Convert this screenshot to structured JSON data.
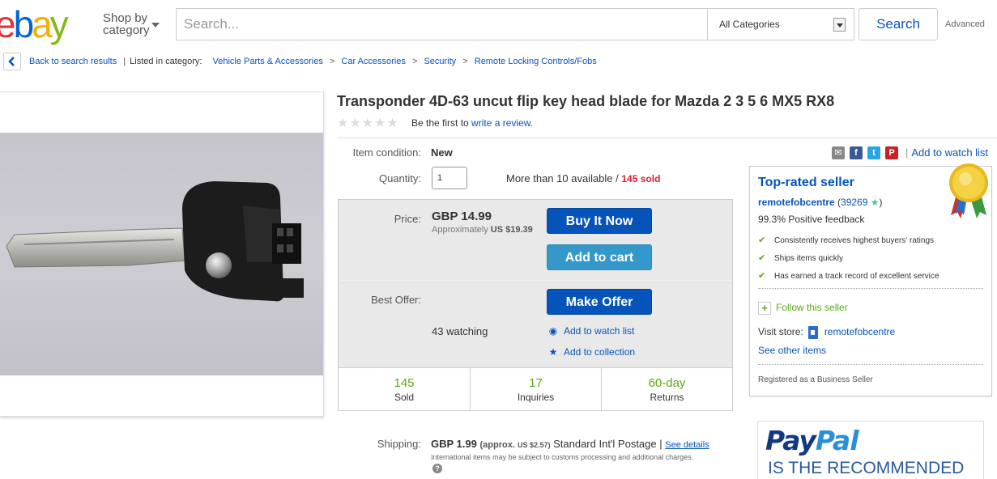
{
  "header": {
    "logo_text": "ebay",
    "shop_by_line1": "Shop by",
    "shop_by_line2": "category",
    "search_placeholder": "Search...",
    "category_selected": "All Categories",
    "search_button": "Search",
    "advanced_link": "Advanced"
  },
  "breadcrumb": {
    "back": "Back to search results",
    "listed_in": "Listed in category:",
    "items": [
      "Vehicle Parts & Accessories",
      "Car Accessories",
      "Security",
      "Remote Locking Controls/Fobs"
    ],
    "separator": ">"
  },
  "listing": {
    "title": "Transponder 4D-63 uncut flip key head blade for Mazda 2 3 5 6 MX5 RX8",
    "stars": "★★★★★",
    "review_prefix": "Be the first to",
    "review_link": "write a review.",
    "condition_label": "Item condition:",
    "condition_value": "New",
    "quantity_label": "Quantity:",
    "quantity_value": "1",
    "availability": "More than 10 available / ",
    "sold_text": "145 sold"
  },
  "buy_box": {
    "price_label": "Price:",
    "price_value": "GBP 14.99",
    "approx_prefix": "Approximately",
    "approx_value": "US $19.39",
    "buy_now": "Buy It Now",
    "add_to_cart": "Add to cart",
    "best_offer_label": "Best Offer:",
    "make_offer": "Make Offer",
    "watching": "43 watching",
    "add_watch_list": "Add to watch list",
    "add_collection": "Add to collection",
    "stats": [
      {
        "number": "145",
        "label": "Sold"
      },
      {
        "number": "17",
        "label": "Inquiries"
      },
      {
        "number": "60-day",
        "label": "Returns"
      }
    ]
  },
  "shipping": {
    "label": "Shipping:",
    "cost": "GBP 1.99",
    "approx_prefix": "(approx.",
    "approx_us": "US $2.57)",
    "service": "Standard Int'l Postage",
    "separator": "|",
    "details_link": "See details",
    "note": "International items may be subject to customs processing and additional charges.",
    "help_glyph": "?"
  },
  "share": {
    "icons": [
      "mail-icon",
      "facebook-icon",
      "twitter-icon",
      "pinterest-icon"
    ],
    "fb_glyph": "f",
    "tw_glyph": "t",
    "pin_glyph": "P",
    "mail_glyph": "✉",
    "watch_list": "Add to watch list"
  },
  "seller": {
    "title": "Top-rated seller",
    "name": "remotefobcentre",
    "feedback_count": "39269",
    "feedback_percent": "99.3% Positive feedback",
    "features": [
      "Consistently receives highest buyers' ratings",
      "Ships items quickly",
      "Has earned a track record of excellent service"
    ],
    "follow": "Follow this seller",
    "visit_store": "Visit store:",
    "store_name": "remotefobcentre",
    "other_items": "See other items",
    "registered": "Registered as a Business Seller"
  },
  "ad": {
    "logo_part1": "Pay",
    "logo_part2": "Pal",
    "tagline": "IS THE RECOMMENDED"
  },
  "colors": {
    "ebay_red": "#e53238",
    "ebay_blue": "#0064d2",
    "ebay_yellow": "#f5af02",
    "ebay_green": "#86b817",
    "link_blue": "#0654ba",
    "stat_green": "#5ba71b",
    "sold_red": "#dd1e31"
  }
}
